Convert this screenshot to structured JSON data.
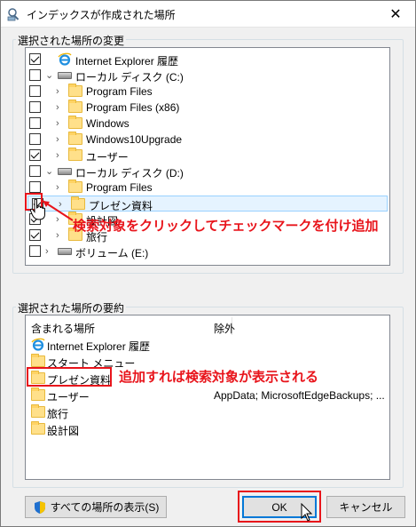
{
  "window": {
    "title": "インデックスが作成された場所",
    "close_glyph": "✕"
  },
  "change_group": {
    "label": "選択された場所の変更"
  },
  "tree_items": [
    {
      "label": "Internet Explorer 履歴",
      "checked": true,
      "kind": "ie"
    },
    {
      "label": "ローカル ディスク (C:)",
      "checked": false,
      "kind": "drive",
      "expanded": true
    },
    {
      "label": "Program Files",
      "checked": false,
      "kind": "folder"
    },
    {
      "label": "Program Files (x86)",
      "checked": false,
      "kind": "folder"
    },
    {
      "label": "Windows",
      "checked": false,
      "kind": "folder"
    },
    {
      "label": "Windows10Upgrade",
      "checked": false,
      "kind": "folder"
    },
    {
      "label": "ユーザー",
      "checked": true,
      "kind": "folder"
    },
    {
      "label": "ローカル ディスク (D:)",
      "checked": false,
      "kind": "drive",
      "expanded": true
    },
    {
      "label": "Program Files",
      "checked": false,
      "kind": "folder"
    },
    {
      "label": "プレゼン資料",
      "checked": true,
      "kind": "folder",
      "selected": true
    },
    {
      "label": "設計図",
      "checked": true,
      "kind": "folder"
    },
    {
      "label": "旅行",
      "checked": true,
      "kind": "folder"
    },
    {
      "label": "ボリューム (E:)",
      "checked": false,
      "kind": "drive",
      "expanded": false
    }
  ],
  "summary_group": {
    "label": "選択された場所の要約",
    "col_included": "含まれる場所",
    "col_excluded": "除外"
  },
  "summary_rows": [
    {
      "label": "Internet Explorer 履歴",
      "kind": "ie",
      "exclude": ""
    },
    {
      "label": "スタート メニュー",
      "kind": "folder",
      "exclude": ""
    },
    {
      "label": "プレゼン資料",
      "kind": "folder",
      "exclude": ""
    },
    {
      "label": "ユーザー",
      "kind": "folder",
      "exclude": "AppData; MicrosoftEdgeBackups; ..."
    },
    {
      "label": "旅行",
      "kind": "folder",
      "exclude": ""
    },
    {
      "label": "設計図",
      "kind": "folder",
      "exclude": ""
    }
  ],
  "annotations": {
    "tree": "検索対象をクリックしてチェックマークを付け追加",
    "summary": "追加すれば検索対象が表示される"
  },
  "buttons": {
    "show_all": "すべての場所の表示(S)",
    "ok": "OK",
    "cancel": "キャンセル"
  },
  "colors": {
    "annotation_red": "#e8141b",
    "accent": "#0078d7"
  }
}
